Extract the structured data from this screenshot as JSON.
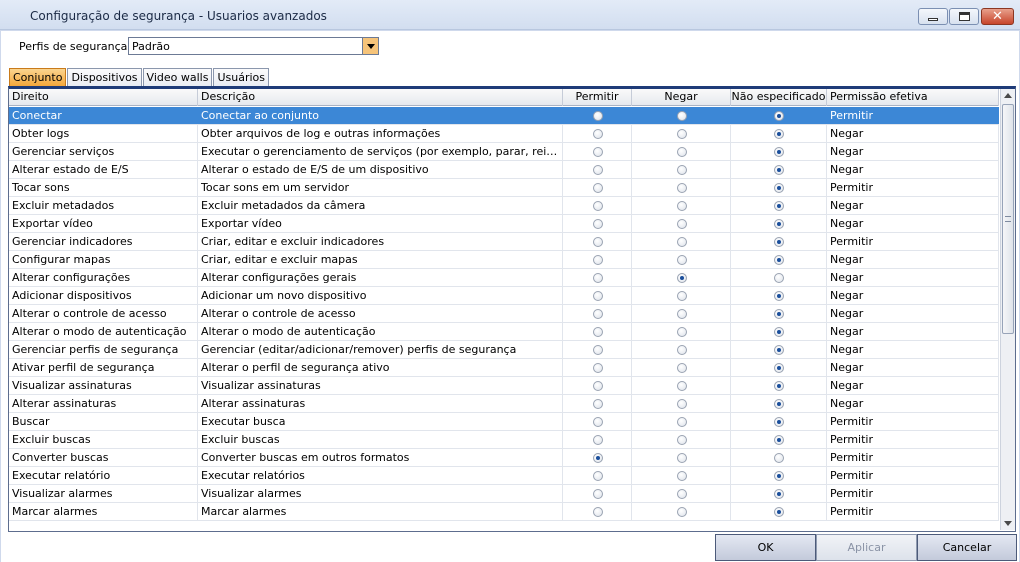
{
  "window": {
    "title": "Configuração de segurança - Usuarios avanzados",
    "min_glyph": "",
    "max_glyph": "",
    "close_glyph": "✕"
  },
  "profile": {
    "label": "Perfis de segurança",
    "selected": "Padrão"
  },
  "tabs": [
    "Conjunto",
    "Dispositivos",
    "Video walls",
    "Usuários"
  ],
  "active_tab": 0,
  "table": {
    "columns": [
      "Direito",
      "Descrição",
      "Permitir",
      "Negar",
      "Não especificado",
      "Permissão efetiva"
    ],
    "rows": [
      {
        "right": "Conectar",
        "description": "Conectar ao conjunto",
        "choice": "unspecified",
        "effective": "Permitir",
        "selected": true
      },
      {
        "right": "Obter logs",
        "description": "Obter arquivos de log e outras informações",
        "choice": "unspecified",
        "effective": "Negar"
      },
      {
        "right": "Gerenciar serviços",
        "description": "Executar o gerenciamento de serviços (por exemplo, parar, reinici...",
        "choice": "unspecified",
        "effective": "Negar"
      },
      {
        "right": "Alterar estado de E/S",
        "description": "Alterar o estado de E/S de um dispositivo",
        "choice": "unspecified",
        "effective": "Negar"
      },
      {
        "right": "Tocar sons",
        "description": "Tocar sons em um servidor",
        "choice": "unspecified",
        "effective": "Permitir"
      },
      {
        "right": "Excluir metadados",
        "description": "Excluir metadados da câmera",
        "choice": "unspecified",
        "effective": "Negar"
      },
      {
        "right": "Exportar vídeo",
        "description": "Exportar vídeo",
        "choice": "unspecified",
        "effective": "Negar"
      },
      {
        "right": "Gerenciar indicadores",
        "description": "Criar, editar e excluir indicadores",
        "choice": "unspecified",
        "effective": "Permitir"
      },
      {
        "right": "Configurar mapas",
        "description": "Criar, editar e excluir mapas",
        "choice": "unspecified",
        "effective": "Negar"
      },
      {
        "right": "Alterar configurações",
        "description": "Alterar configurações gerais",
        "choice": "deny",
        "effective": "Negar"
      },
      {
        "right": "Adicionar dispositivos",
        "description": "Adicionar um novo dispositivo",
        "choice": "unspecified",
        "effective": "Negar"
      },
      {
        "right": "Alterar o controle de acesso",
        "description": "Alterar o controle de acesso",
        "choice": "unspecified",
        "effective": "Negar"
      },
      {
        "right": "Alterar o modo de autenticação",
        "description": "Alterar o modo de autenticação",
        "choice": "unspecified",
        "effective": "Negar"
      },
      {
        "right": "Gerenciar perfis de segurança",
        "description": "Gerenciar (editar/adicionar/remover) perfis de segurança",
        "choice": "unspecified",
        "effective": "Negar"
      },
      {
        "right": "Ativar perfil de segurança",
        "description": "Alterar o perfil de segurança ativo",
        "choice": "unspecified",
        "effective": "Negar"
      },
      {
        "right": "Visualizar assinaturas",
        "description": "Visualizar assinaturas",
        "choice": "unspecified",
        "effective": "Negar"
      },
      {
        "right": "Alterar assinaturas",
        "description": "Alterar assinaturas",
        "choice": "unspecified",
        "effective": "Negar"
      },
      {
        "right": "Buscar",
        "description": "Executar busca",
        "choice": "unspecified",
        "effective": "Permitir"
      },
      {
        "right": "Excluir buscas",
        "description": "Excluir buscas",
        "choice": "unspecified",
        "effective": "Permitir"
      },
      {
        "right": "Converter buscas",
        "description": "Converter buscas em outros formatos",
        "choice": "allow",
        "effective": "Permitir"
      },
      {
        "right": "Executar relatório",
        "description": "Executar relatórios",
        "choice": "unspecified",
        "effective": "Permitir"
      },
      {
        "right": "Visualizar alarmes",
        "description": "Visualizar alarmes",
        "choice": "unspecified",
        "effective": "Permitir"
      },
      {
        "right": "Marcar alarmes",
        "description": "Marcar alarmes",
        "choice": "unspecified",
        "effective": "Permitir"
      }
    ]
  },
  "buttons": {
    "ok": "OK",
    "apply": "Aplicar",
    "cancel": "Cancelar"
  },
  "colors": {
    "selection": "#3c87d6",
    "active_tab": "#f3a436",
    "combo_arrow": "#f6c47a"
  }
}
